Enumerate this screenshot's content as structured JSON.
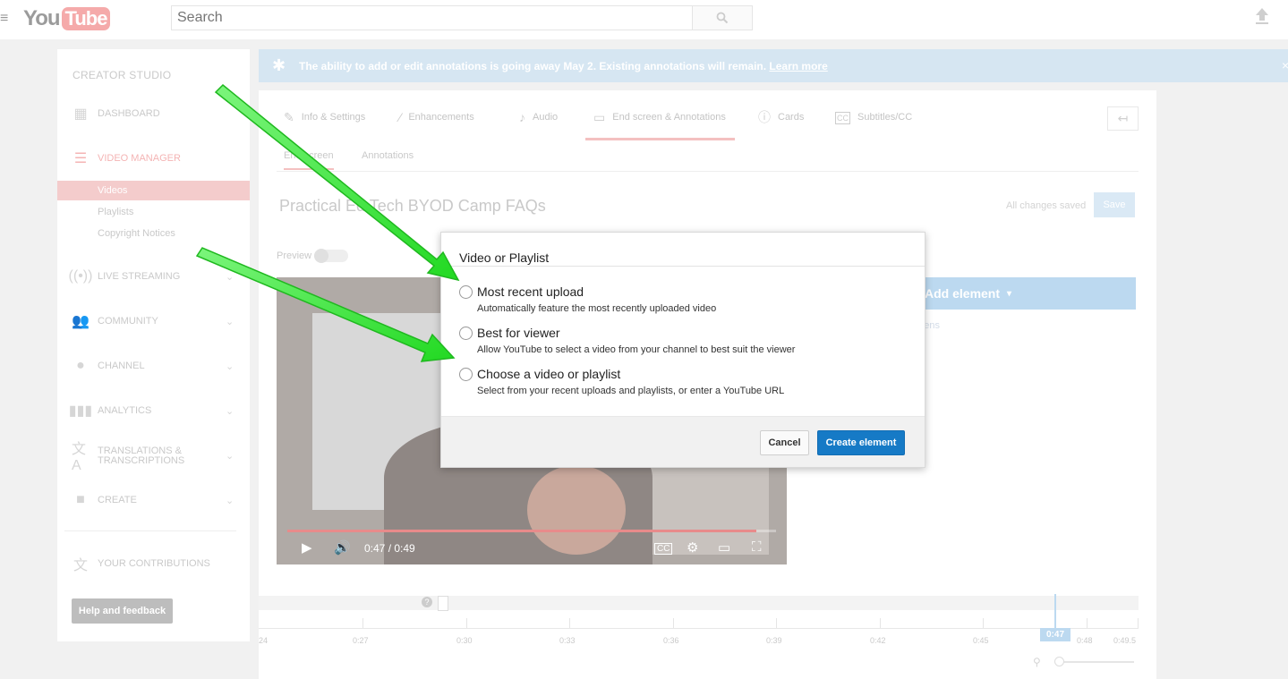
{
  "masthead": {
    "logo_you": "You",
    "logo_tube": "Tube",
    "search_placeholder": "Search"
  },
  "sidebar": {
    "title": "CREATOR STUDIO",
    "items": [
      {
        "label": "DASHBOARD",
        "icon": "dashboard-icon"
      },
      {
        "label": "VIDEO MANAGER",
        "icon": "video-manager-icon"
      },
      {
        "label": "LIVE STREAMING",
        "icon": "live-streaming-icon"
      },
      {
        "label": "COMMUNITY",
        "icon": "community-icon"
      },
      {
        "label": "CHANNEL",
        "icon": "channel-icon"
      },
      {
        "label": "ANALYTICS",
        "icon": "analytics-icon"
      },
      {
        "label": "TRANSLATIONS &",
        "label2": "TRANSCRIPTIONS",
        "icon": "translate-icon"
      },
      {
        "label": "CREATE",
        "icon": "create-icon"
      },
      {
        "label": "YOUR CONTRIBUTIONS",
        "icon": "contributions-icon"
      }
    ],
    "sub_items": [
      "Videos",
      "Playlists",
      "Copyright Notices"
    ],
    "help_label": "Help and feedback"
  },
  "banner": {
    "text": "The ability to add or edit annotations is going away May 2. Existing annotations will remain.",
    "link": "Learn more",
    "close": "×"
  },
  "tabs": [
    {
      "label": "Info & Settings",
      "icon": "pencil-icon"
    },
    {
      "label": "Enhancements",
      "icon": "magic-wand-icon"
    },
    {
      "label": "Audio",
      "icon": "music-note-icon"
    },
    {
      "label": "End screen & Annotations",
      "icon": "end-screen-icon"
    },
    {
      "label": "Cards",
      "icon": "info-icon"
    },
    {
      "label": "Subtitles/CC",
      "icon": "cc-icon"
    }
  ],
  "subtabs": [
    "End screen",
    "Annotations"
  ],
  "video": {
    "title": "Practical Ed Tech BYOD Camp FAQs",
    "saved_status": "All changes saved",
    "save_label": "Save",
    "preview_label": "Preview",
    "time": "0:47 / 0:49",
    "progress": 0.96
  },
  "add_element": {
    "label": "Add element",
    "caret": "▾",
    "screens_hint": "creens"
  },
  "timeline": {
    "ticks": [
      "24",
      "0:27",
      "0:30",
      "0:33",
      "0:36",
      "0:39",
      "0:42",
      "0:45",
      "0:48",
      "0:49.5"
    ],
    "playhead": "0:47",
    "help": "?"
  },
  "dialog": {
    "title": "Video or Playlist",
    "options": [
      {
        "label": "Most recent upload",
        "desc": "Automatically feature the most recently uploaded video"
      },
      {
        "label": "Best for viewer",
        "desc": "Allow YouTube to select a video from your channel to best suit the viewer"
      },
      {
        "label": "Choose a video or playlist",
        "desc": "Select from your recent uploads and playlists, or enter a YouTube URL"
      }
    ],
    "cancel_label": "Cancel",
    "create_label": "Create element"
  },
  "colors": {
    "primary_blue": "#167ac6",
    "arrow_green": "#2ee82e",
    "active_pink": "#f4cccc"
  }
}
